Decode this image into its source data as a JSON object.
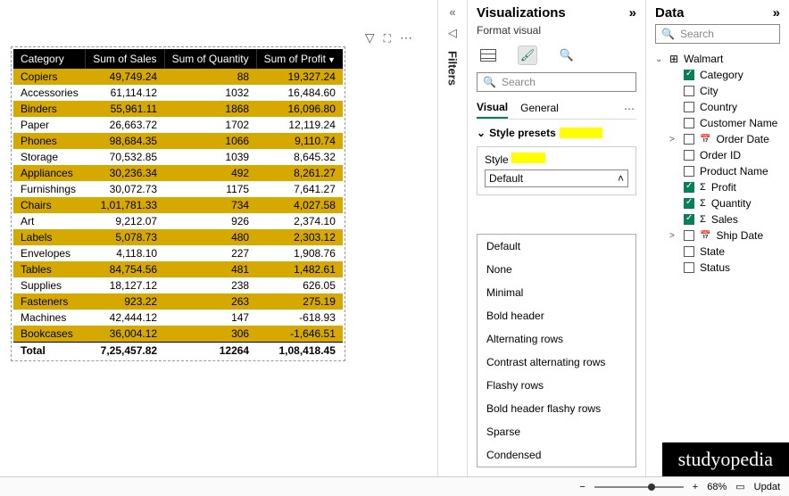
{
  "filters_label": "Filters",
  "viz": {
    "title": "Visualizations",
    "subtitle": "Format visual",
    "search_placeholder": "Search",
    "tabs": {
      "visual": "Visual",
      "general": "General"
    },
    "section": "Style presets",
    "style_label": "Style",
    "selected_style": "Default",
    "style_options": [
      "Default",
      "None",
      "Minimal",
      "Bold header",
      "Alternating rows",
      "Contrast alternating rows",
      "Flashy rows",
      "Bold header flashy rows",
      "Sparse",
      "Condensed"
    ]
  },
  "data": {
    "title": "Data",
    "search_placeholder": "Search",
    "table_name": "Walmart",
    "fields": [
      {
        "name": "Category",
        "checked": true
      },
      {
        "name": "City",
        "checked": false
      },
      {
        "name": "Country",
        "checked": false
      },
      {
        "name": "Customer Name",
        "checked": false
      },
      {
        "name": "Order Date",
        "checked": false,
        "exp": true,
        "date": true
      },
      {
        "name": "Order ID",
        "checked": false
      },
      {
        "name": "Product Name",
        "checked": false
      },
      {
        "name": "Profit",
        "checked": true,
        "sigma": true
      },
      {
        "name": "Quantity",
        "checked": true,
        "sigma": true
      },
      {
        "name": "Sales",
        "checked": true,
        "sigma": true
      },
      {
        "name": "Ship Date",
        "checked": false,
        "exp": true,
        "date": true
      },
      {
        "name": "State",
        "checked": false
      },
      {
        "name": "Status",
        "checked": false
      }
    ]
  },
  "table": {
    "headers": [
      "Category",
      "Sum of Sales",
      "Sum of Quantity",
      "Sum of Profit"
    ],
    "rows": [
      {
        "c": "Copiers",
        "s": "49,749.24",
        "q": "88",
        "p": "19,327.24",
        "hl": true
      },
      {
        "c": "Accessories",
        "s": "61,114.12",
        "q": "1032",
        "p": "16,484.60"
      },
      {
        "c": "Binders",
        "s": "55,961.11",
        "q": "1868",
        "p": "16,096.80",
        "hl": true
      },
      {
        "c": "Paper",
        "s": "26,663.72",
        "q": "1702",
        "p": "12,119.24"
      },
      {
        "c": "Phones",
        "s": "98,684.35",
        "q": "1066",
        "p": "9,110.74",
        "hl": true
      },
      {
        "c": "Storage",
        "s": "70,532.85",
        "q": "1039",
        "p": "8,645.32"
      },
      {
        "c": "Appliances",
        "s": "30,236.34",
        "q": "492",
        "p": "8,261.27",
        "hl": true
      },
      {
        "c": "Furnishings",
        "s": "30,072.73",
        "q": "1175",
        "p": "7,641.27"
      },
      {
        "c": "Chairs",
        "s": "1,01,781.33",
        "q": "734",
        "p": "4,027.58",
        "hl": true
      },
      {
        "c": "Art",
        "s": "9,212.07",
        "q": "926",
        "p": "2,374.10"
      },
      {
        "c": "Labels",
        "s": "5,078.73",
        "q": "480",
        "p": "2,303.12",
        "hl": true
      },
      {
        "c": "Envelopes",
        "s": "4,118.10",
        "q": "227",
        "p": "1,908.76"
      },
      {
        "c": "Tables",
        "s": "84,754.56",
        "q": "481",
        "p": "1,482.61",
        "hl": true
      },
      {
        "c": "Supplies",
        "s": "18,127.12",
        "q": "238",
        "p": "626.05"
      },
      {
        "c": "Fasteners",
        "s": "923.22",
        "q": "263",
        "p": "275.19",
        "hl": true
      },
      {
        "c": "Machines",
        "s": "42,444.12",
        "q": "147",
        "p": "-618.93"
      },
      {
        "c": "Bookcases",
        "s": "36,004.12",
        "q": "306",
        "p": "-1,646.51",
        "hl": true
      }
    ],
    "total": {
      "label": "Total",
      "s": "7,25,457.82",
      "q": "12264",
      "p": "1,08,418.45"
    }
  },
  "status": {
    "zoom": "68%",
    "update": "Updat"
  },
  "brand": "studyopedia"
}
